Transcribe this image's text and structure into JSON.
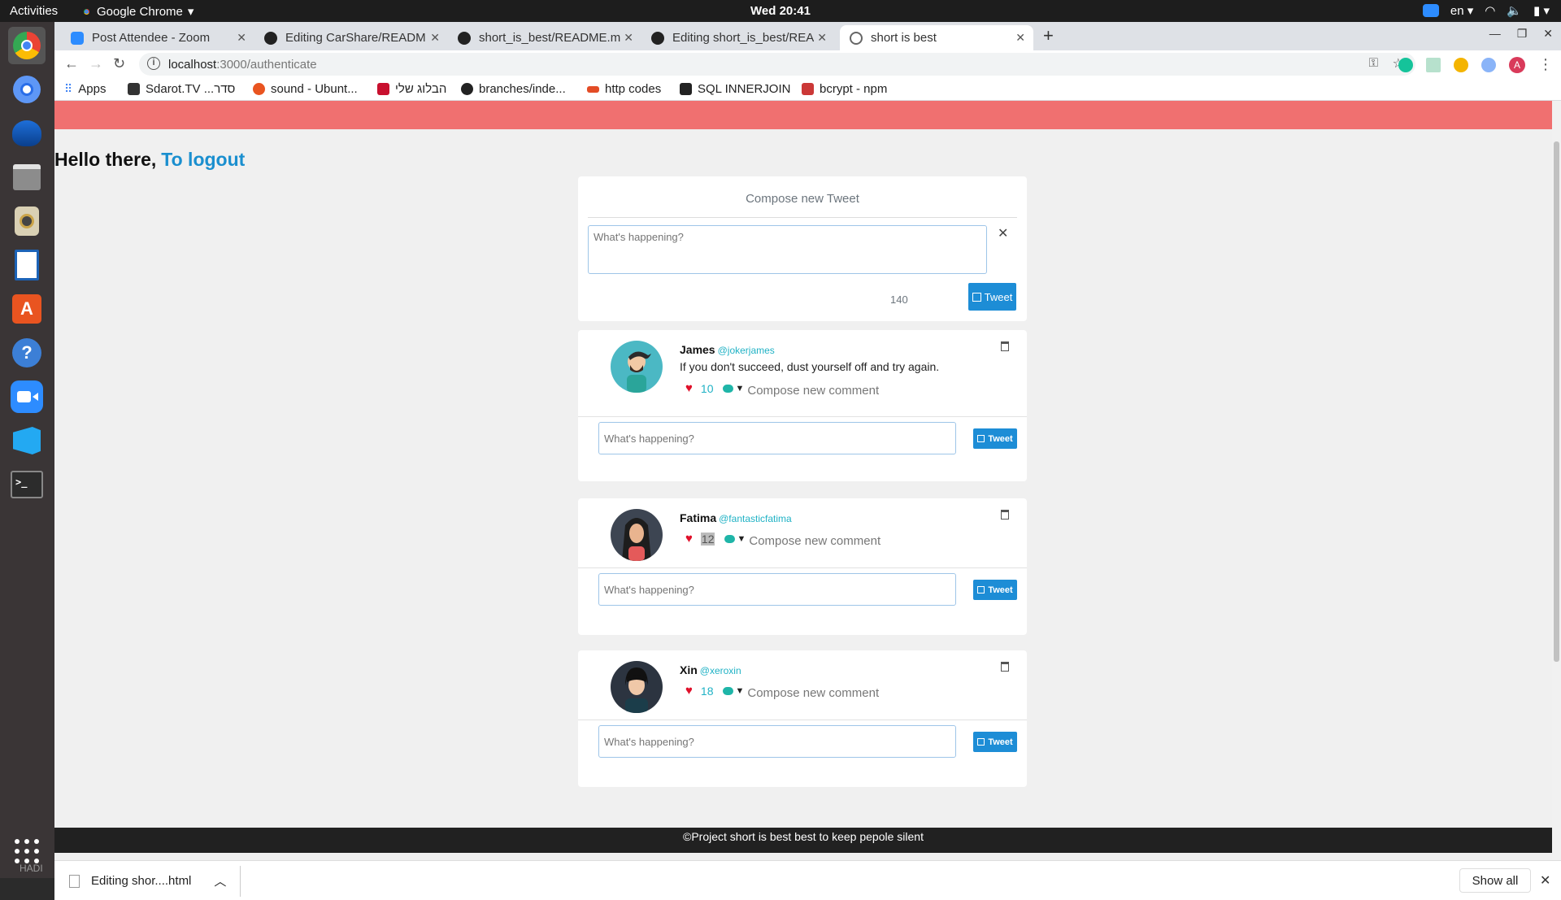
{
  "system": {
    "activities": "Activities",
    "app_name": "Google Chrome",
    "clock": "Wed 20:41",
    "language": "en",
    "username_watermark": "HADI"
  },
  "tabs": [
    {
      "title": "Post Attendee - Zoom",
      "fav_color": "#2d8cff"
    },
    {
      "title": "Editing CarShare/READM",
      "fav_color": "#222222"
    },
    {
      "title": "short_is_best/README.m",
      "fav_color": "#222222"
    },
    {
      "title": "Editing short_is_best/REA",
      "fav_color": "#222222"
    },
    {
      "title": "short is best",
      "fav_color": "#666666"
    }
  ],
  "address": {
    "host": "localhost",
    "path": ":3000/authenticate"
  },
  "bookmarks": [
    {
      "label": "Apps",
      "color": "#4285f4"
    },
    {
      "label": "Sdarot.TV ...סדר",
      "color": "#333333"
    },
    {
      "label": "sound - Ubunt...",
      "color": "#e95420"
    },
    {
      "label": "הבלוג שלי",
      "color": "#c8102e"
    },
    {
      "label": "branches/inde...",
      "color": "#222222"
    },
    {
      "label": "http codes",
      "color": "#e34c26"
    },
    {
      "label": "SQL INNERJOIN",
      "color": "#222222"
    },
    {
      "label": "bcrypt - npm",
      "color": "#cb3837"
    }
  ],
  "page": {
    "greeting": "Hello there,",
    "logout": "To logout",
    "compose": {
      "title": "Compose new Tweet",
      "placeholder": "What's happening?",
      "counter": "140",
      "button": "Tweet",
      "close": "✕"
    },
    "posts": [
      {
        "name": "James",
        "handle": "@jokerjames",
        "text": "If you don't succeed, dust yourself off and try again.",
        "likes": "10",
        "comment_label": "Compose new comment",
        "placeholder": "What's happening?",
        "button": "Tweet"
      },
      {
        "name": "Fatima",
        "handle": "@fantasticfatima",
        "text": "",
        "likes": "12",
        "comment_label": "Compose new comment",
        "placeholder": "What's happening?",
        "button": "Tweet"
      },
      {
        "name": "Xin",
        "handle": "@xeroxin",
        "text": "",
        "likes": "18",
        "comment_label": "Compose new comment",
        "placeholder": "What's happening?",
        "button": "Tweet"
      }
    ],
    "footer": "©Project short is best best to keep pepole silent"
  },
  "downloads": {
    "file": "Editing shor....html",
    "show_all": "Show all"
  },
  "colors": {
    "accent": "#1d8dd6",
    "header_bar": "#f07070",
    "handle": "#20b2c5",
    "heart": "#e0102a"
  }
}
